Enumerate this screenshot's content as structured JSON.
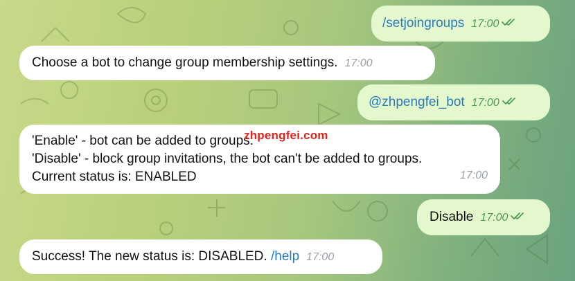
{
  "messages": [
    {
      "text": "/setjoingroups",
      "time": "17:00"
    },
    {
      "text": "Choose a bot to change group membership settings.",
      "time": "17:00"
    },
    {
      "text": "@zhpengfei_bot",
      "time": "17:00"
    },
    {
      "lines": [
        "'Enable' - bot can be added to groups.",
        "'Disable' - block group invitations, the bot can't be added to groups.",
        "Current status is: ENABLED"
      ],
      "time": "17:00"
    },
    {
      "text": "Disable",
      "time": "17:00"
    },
    {
      "text": "Success! The new status is: DISABLED.",
      "link": "/help",
      "time": "17:00"
    }
  ],
  "watermark": "zhpengfei.com",
  "colors": {
    "incoming_bubble": "#ffffff",
    "outgoing_bubble": "#e3f8cd",
    "link": "#2a7ab8",
    "outgoing_time": "#4f9a50",
    "watermark": "#e0241b"
  },
  "icons": {
    "read_receipt": "double-check-icon"
  }
}
